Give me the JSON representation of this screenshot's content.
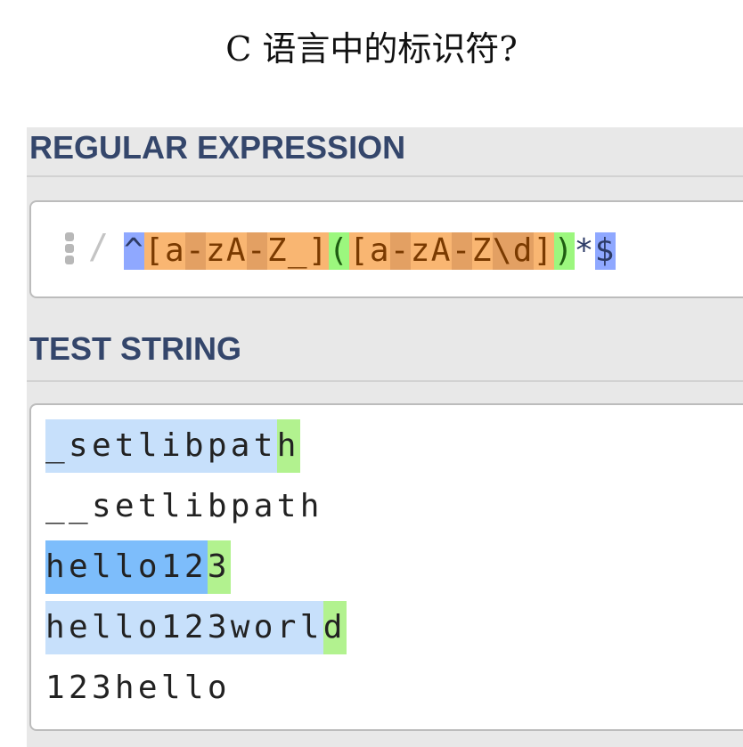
{
  "page": {
    "title": "C 语言中的标识符?"
  },
  "regex_section": {
    "heading": "REGULAR EXPRESSION",
    "delimiter": "/",
    "tokens": [
      {
        "text": "^",
        "role": "anchor",
        "bg": "#8fa8ff",
        "fg": "#2d3b66"
      },
      {
        "text": "[",
        "role": "charset",
        "bg": "#f9b672",
        "fg": "#7a3a00"
      },
      {
        "text": "a",
        "role": "charset",
        "bg": "#f9b672",
        "fg": "#7a3a00"
      },
      {
        "text": "-",
        "role": "range",
        "bg": "#e3a063",
        "fg": "#7a3a00"
      },
      {
        "text": "z",
        "role": "charset",
        "bg": "#f9b672",
        "fg": "#7a3a00"
      },
      {
        "text": "A",
        "role": "charset",
        "bg": "#f9b672",
        "fg": "#7a3a00"
      },
      {
        "text": "-",
        "role": "range",
        "bg": "#e3a063",
        "fg": "#7a3a00"
      },
      {
        "text": "Z",
        "role": "charset",
        "bg": "#f9b672",
        "fg": "#7a3a00"
      },
      {
        "text": "_",
        "role": "charset",
        "bg": "#f9b672",
        "fg": "#7a3a00"
      },
      {
        "text": "]",
        "role": "charset",
        "bg": "#f9b672",
        "fg": "#7a3a00"
      },
      {
        "text": "(",
        "role": "group",
        "bg": "#9cf77e",
        "fg": "#1f5d12"
      },
      {
        "text": "[",
        "role": "charset",
        "bg": "#f9b672",
        "fg": "#7a3a00"
      },
      {
        "text": "a",
        "role": "charset",
        "bg": "#f9b672",
        "fg": "#7a3a00"
      },
      {
        "text": "-",
        "role": "range",
        "bg": "#e3a063",
        "fg": "#7a3a00"
      },
      {
        "text": "z",
        "role": "charset",
        "bg": "#f9b672",
        "fg": "#7a3a00"
      },
      {
        "text": "A",
        "role": "charset",
        "bg": "#f9b672",
        "fg": "#7a3a00"
      },
      {
        "text": "-",
        "role": "range",
        "bg": "#e3a063",
        "fg": "#7a3a00"
      },
      {
        "text": "Z",
        "role": "charset",
        "bg": "#f9b672",
        "fg": "#7a3a00"
      },
      {
        "text": "\\d",
        "role": "escape",
        "bg": "#e3a063",
        "fg": "#7a3a00"
      },
      {
        "text": "]",
        "role": "charset",
        "bg": "#f9b672",
        "fg": "#7a3a00"
      },
      {
        "text": ")",
        "role": "group",
        "bg": "#9cf77e",
        "fg": "#1f5d12"
      },
      {
        "text": "*",
        "role": "quantifier",
        "bg": "#ffffff",
        "fg": "#2d3b66"
      },
      {
        "text": "$",
        "role": "anchor",
        "bg": "#8fa8ff",
        "fg": "#2d3b66"
      }
    ]
  },
  "test_section": {
    "heading": "TEST STRING",
    "lines": [
      {
        "segments": [
          {
            "text": "_setlibpat",
            "highlight": "match",
            "bg": "#c7e0fb"
          },
          {
            "text": "h",
            "highlight": "group",
            "bg": "#b2f28f"
          }
        ]
      },
      {
        "segments": [
          {
            "text": "__setlibpath",
            "highlight": "none",
            "bg": "transparent"
          }
        ]
      },
      {
        "segments": [
          {
            "text": "hello12",
            "highlight": "match-selected",
            "bg": "#7dbdfb"
          },
          {
            "text": "3",
            "highlight": "group",
            "bg": "#b2f28f"
          }
        ]
      },
      {
        "segments": [
          {
            "text": "hello123worl",
            "highlight": "match",
            "bg": "#c7e0fb"
          },
          {
            "text": "d",
            "highlight": "group",
            "bg": "#b2f28f"
          }
        ]
      },
      {
        "segments": [
          {
            "text": "123hello",
            "highlight": "none",
            "bg": "transparent"
          }
        ]
      }
    ]
  }
}
